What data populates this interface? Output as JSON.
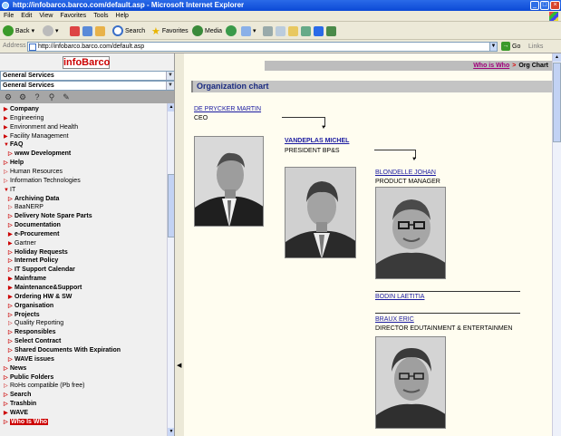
{
  "window": {
    "title": "http://infobarco.barco.com/default.asp - Microsoft Internet Explorer"
  },
  "menu": {
    "items": [
      "File",
      "Edit",
      "View",
      "Favorites",
      "Tools",
      "Help"
    ]
  },
  "toolbar": {
    "back": "Back",
    "search": "Search",
    "favorites": "Favorites",
    "media": "Media"
  },
  "address": {
    "label": "Address",
    "url": "http://infobarco.barco.com/default.asp",
    "go": "Go",
    "links": "Links"
  },
  "sidebar": {
    "logo_left": "info",
    "logo_right": "Barco",
    "select1": "General Services",
    "select2": "General Services",
    "items": [
      {
        "label": "Company",
        "bold": true,
        "marker": "▶"
      },
      {
        "label": "Engineering",
        "bold": false,
        "marker": "▶"
      },
      {
        "label": "Environment and Health",
        "bold": false,
        "marker": "▶"
      },
      {
        "label": "Facility Management",
        "bold": false,
        "marker": "▶"
      },
      {
        "label": "FAQ",
        "bold": true,
        "marker": "▼"
      },
      {
        "label": "www Development",
        "bold": true,
        "marker": "▷",
        "indent": true
      },
      {
        "label": "Help",
        "bold": true,
        "marker": "▷"
      },
      {
        "label": "Human Resources",
        "bold": false,
        "marker": "▷"
      },
      {
        "label": "Information Technologies",
        "bold": false,
        "marker": "▷"
      },
      {
        "label": "IT",
        "bold": false,
        "marker": "▼"
      },
      {
        "label": "Archiving Data",
        "bold": true,
        "marker": "▷",
        "indent": true
      },
      {
        "label": "BaaNERP",
        "bold": false,
        "marker": "▷",
        "indent": true
      },
      {
        "label": "Delivery Note Spare Parts",
        "bold": true,
        "marker": "▷",
        "indent": true
      },
      {
        "label": "Documentation",
        "bold": true,
        "marker": "▷",
        "indent": true
      },
      {
        "label": "e-Procurement",
        "bold": true,
        "marker": "▶",
        "indent": true
      },
      {
        "label": "Gartner",
        "bold": false,
        "marker": "▶",
        "indent": true
      },
      {
        "label": "Holiday Requests",
        "bold": true,
        "marker": "▷",
        "indent": true
      },
      {
        "label": "Internet Policy",
        "bold": true,
        "marker": "▷",
        "indent": true
      },
      {
        "label": "IT Support Calendar",
        "bold": true,
        "marker": "▷",
        "indent": true
      },
      {
        "label": "Mainframe",
        "bold": true,
        "marker": "▶",
        "indent": true
      },
      {
        "label": "Maintenance&Support",
        "bold": true,
        "marker": "▶",
        "indent": true
      },
      {
        "label": "Ordering HW & SW",
        "bold": true,
        "marker": "▶",
        "indent": true
      },
      {
        "label": "Organisation",
        "bold": true,
        "marker": "▷",
        "indent": true
      },
      {
        "label": "Projects",
        "bold": true,
        "marker": "▷",
        "indent": true
      },
      {
        "label": "Quality Reporting",
        "bold": false,
        "marker": "▷",
        "indent": true
      },
      {
        "label": "Responsibles",
        "bold": true,
        "marker": "▷",
        "indent": true
      },
      {
        "label": "Select Contract",
        "bold": true,
        "marker": "▷",
        "indent": true
      },
      {
        "label": "Shared Documents With Expiration",
        "bold": true,
        "marker": "▷",
        "indent": true
      },
      {
        "label": "WAVE issues",
        "bold": true,
        "marker": "▷",
        "indent": true
      },
      {
        "label": "News",
        "bold": true,
        "marker": "▷"
      },
      {
        "label": "Public Folders",
        "bold": true,
        "marker": "▷"
      },
      {
        "label": "RoHs compatible (Pb free)",
        "bold": false,
        "marker": "▷"
      },
      {
        "label": "Search",
        "bold": true,
        "marker": "▷"
      },
      {
        "label": "Trashbin",
        "bold": true,
        "marker": "▷"
      },
      {
        "label": "WAVE",
        "bold": true,
        "marker": "▶"
      },
      {
        "label": "Who Is Who",
        "bold": true,
        "marker": "▷",
        "selected": true
      }
    ]
  },
  "content": {
    "crumb_link": "Who is Who",
    "crumb_sep": ">",
    "crumb_current": "Org Chart",
    "heading": "Organization chart",
    "people": [
      {
        "name": "DE PRYCKER MARTIN",
        "title": "CEO"
      },
      {
        "name": "VANDEPLAS MICHEL",
        "title": "PRESIDENT BP&S"
      },
      {
        "name": "BLONDELLE JOHAN",
        "title": "PRODUCT MANAGER"
      },
      {
        "name": "BODIN LAETITIA",
        "title": ""
      },
      {
        "name": "BRAUX ERIC",
        "title": "DIRECTOR EDUTAINMENT & ENTERTAINMEN"
      }
    ]
  },
  "colors": {
    "accent": "#c00000",
    "heading_text": "#1a2a80",
    "link": "#1a1aa0",
    "crumb_link": "#a0007a",
    "content_bg": "#fffdf0"
  }
}
